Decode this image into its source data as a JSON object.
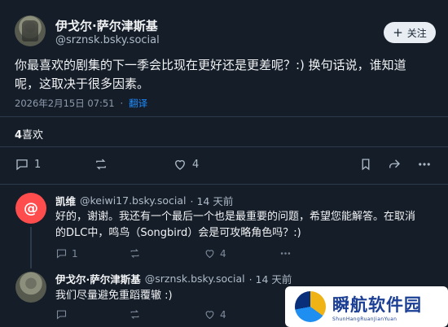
{
  "post": {
    "author_name": "伊戈尔·萨尔津斯基",
    "author_handle": "@srznsk.bsky.social",
    "follow_label": "关注",
    "text": "你最喜欢的剧集的下一季会比现在更好还是更差呢？:) 换句话说，谁知道呢，这取决于很多因素。",
    "date": "2026年2月15日 07:51",
    "translate_label": "翻译",
    "likes_count": "4",
    "likes_label": "喜欢",
    "actions": {
      "reply_count": "1",
      "like_count": "4"
    }
  },
  "replies": [
    {
      "author_name": "凯维",
      "author_handle": "@keiwi17.bsky.social",
      "time": "· 14 天前",
      "text_line1": "好的，谢谢。我还有一个最后一个也是最重要的问题，希望您能解答。在取消",
      "text_line2": "的DLC中，鸣鸟（Songbird）会是可攻略角色吗？:)",
      "reply_count": "1",
      "like_count": "4"
    },
    {
      "author_name": "伊戈尔·萨尔津斯基",
      "author_handle": "@srznsk.bsky.social",
      "time": "· 14 天前",
      "text": "我们尽量避免重蹈覆辙 :)",
      "like_count": "4"
    }
  ],
  "watermark": {
    "title": "瞬航软件园",
    "subtitle": "ShunHangRuanJianYuan"
  },
  "colors": {
    "background": "#151d28",
    "link": "#1d8cff",
    "text": "#f1f3f5",
    "muted": "#aebbc9"
  }
}
